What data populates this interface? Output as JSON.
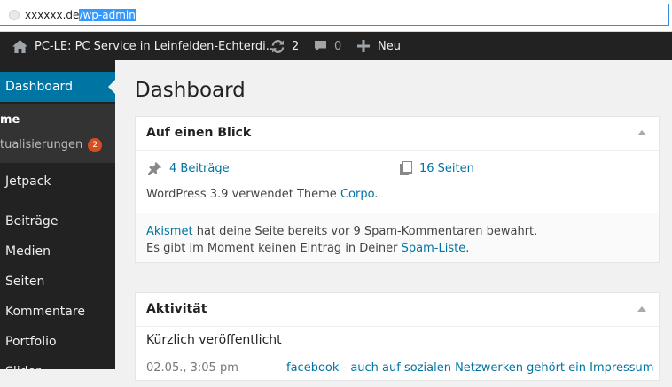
{
  "browser": {
    "url_host": "xxxxxx.de",
    "url_path": "/wp-admin"
  },
  "adminbar": {
    "site_name": "PC-LE: PC Service in Leinfelden-Echterdi...",
    "updates_count": "2",
    "comments_count": "0",
    "new_label": "Neu"
  },
  "sidebar": {
    "dashboard": "Dashboard",
    "sub_home": "me",
    "sub_updates": "tualisierungen",
    "sub_updates_badge": "2",
    "jetpack": "Jetpack",
    "items": [
      "Beiträge",
      "Medien",
      "Seiten",
      "Kommentare",
      "Portfolio",
      "Slider"
    ]
  },
  "page_title": "Dashboard",
  "glance": {
    "title": "Auf einen Blick",
    "posts": "4 Beiträge",
    "pages": "16 Seiten",
    "theme_prefix": "WordPress 3.9 verwendet Theme ",
    "theme_name": "Corpo",
    "theme_suffix": ".",
    "akismet_link": "Akismet",
    "akismet_text": " hat deine Seite bereits vor 9 Spam-Kommentaren bewahrt.",
    "spam_prefix": "Es gibt im Moment keinen Eintrag in Deiner ",
    "spam_link": "Spam-Liste",
    "spam_suffix": "."
  },
  "activity": {
    "title": "Aktivität",
    "recent_heading": "Kürzlich veröffentlicht",
    "row_date": "02.05., 3:05 pm",
    "row_link": "facebook - auch auf sozialen Netzwerken gehört ein Impressum"
  },
  "colors": {
    "accent": "#0074a2",
    "adminbar_bg": "#222222",
    "badge": "#d54e21"
  }
}
